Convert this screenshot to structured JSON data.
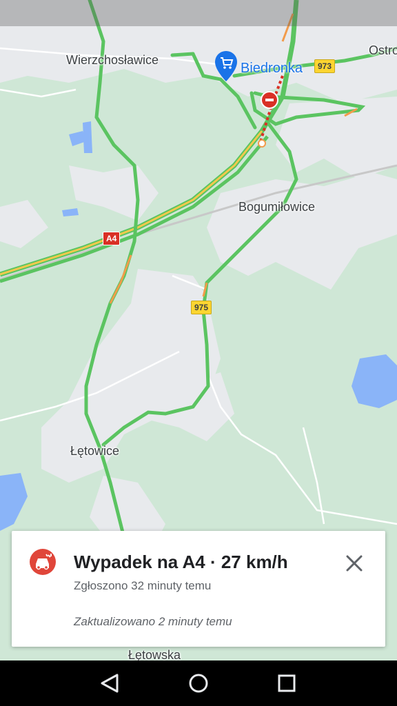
{
  "map": {
    "places": {
      "wierzchoslawice": "Wierzchosławice",
      "ostro": "Ostro",
      "bogumilowice": "Bogumiłowice",
      "letowice": "Łętowice",
      "letowska": "Łętowska"
    },
    "poi": {
      "name": "Biedronka",
      "icon": "shopping-cart-icon",
      "color": "#1a73e8"
    },
    "road_shields": {
      "r973": "973",
      "a4": "A4",
      "r975": "975"
    },
    "colors": {
      "traffic_free": "#5bc461",
      "traffic_slow": "#f29b4b",
      "incident": "#d93025",
      "water": "#8ab4f8",
      "urban": "#e8eaed"
    }
  },
  "incident": {
    "icon": "car-crash-icon",
    "title": "Wypadek na A4 · 27 km/h",
    "reported": "Zgłoszono 32 minuty temu",
    "updated": "Zaktualizowano 2 minuty temu",
    "close_icon": "close-icon"
  },
  "navbar": {
    "back_icon": "back-triangle-icon",
    "home_icon": "home-circle-icon",
    "recents_icon": "recents-square-icon"
  }
}
